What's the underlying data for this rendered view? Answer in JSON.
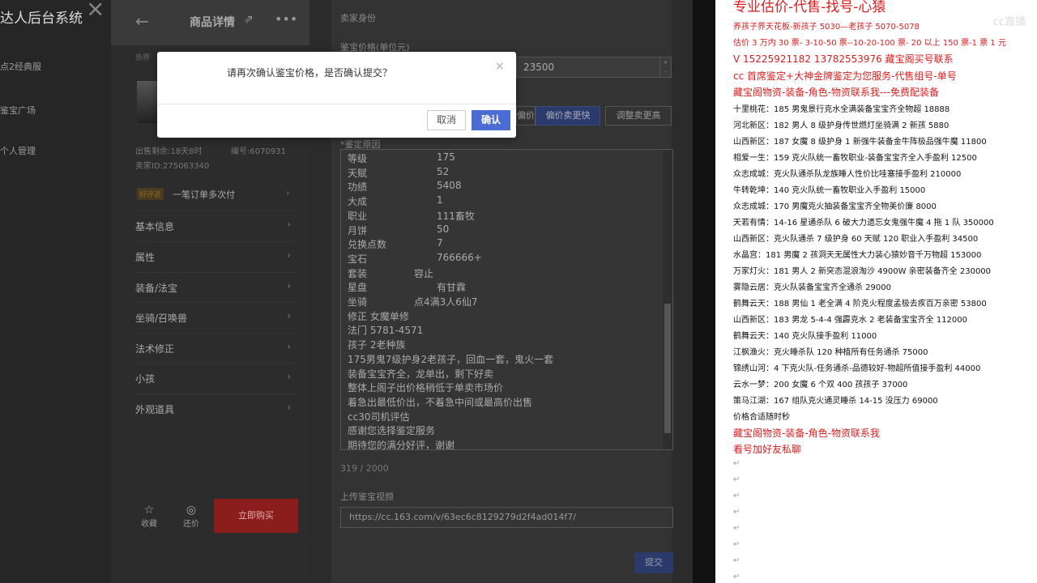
{
  "sidebar": {
    "brand": "达人后台系统",
    "items": [
      "点2经典服",
      "鉴宝广场",
      "个人管理"
    ]
  },
  "product": {
    "title": "商品详情",
    "crumb": "热界",
    "listed": "出售剩余:18天8时",
    "id_label": "编号:6070931",
    "seller": "卖家ID:275063340",
    "promo_tag": "好评返",
    "promo_text": "一笔订单多次付",
    "menu": [
      "基本信息",
      "属性",
      "装备/法宝",
      "坐骑/召唤兽",
      "法术修正",
      "小孩",
      "外观道具"
    ],
    "fav": "收藏",
    "bargain": "还价",
    "buy": "立即购买"
  },
  "form": {
    "section": "卖家身份",
    "price_label": "鉴宝价格(单位元)",
    "price_value": "23500",
    "tabs": [
      "偏价",
      "偏价卖更快",
      "调整卖更高"
    ],
    "reason_label": "*鉴定原因",
    "reason_lines": [
      [
        "等级",
        "175"
      ],
      [
        "天赋",
        "52"
      ],
      [
        "功绩",
        "5408"
      ],
      [
        "大成",
        "1"
      ],
      [
        "职业",
        "111畜牧"
      ],
      [
        "月饼",
        "50"
      ],
      [
        "兑换点数",
        "7"
      ],
      [
        "宝石",
        "766666+"
      ],
      [
        "套装",
        "容止"
      ],
      [
        "星盘",
        "有甘霖"
      ],
      [
        "坐骑",
        "点4满3人6仙7"
      ]
    ],
    "reason_free": [
      "修正 女魔单修",
      "法门 5781-4571",
      "孩子                2老种族",
      "175男鬼7级护身2老孩子，回血一套，鬼火一套",
      "装备宝宝齐全，龙单出，剩下好卖",
      "整体上阁子出价格稍低于单卖市场价",
      "着急出最低价出，不着急中间或最高价出售",
      "cc30司机评估",
      "感谢您选择鉴定服务",
      "期待您的满分好评，谢谢"
    ],
    "counter": "319 / 2000",
    "video_label": "上传鉴宝视频",
    "video_url": "https://cc.163.com/v/63ec6c8129279d2f4ad014f7/",
    "submit": "提交"
  },
  "dialog": {
    "message": "请再次确认鉴宝价格，是否确认提交？",
    "cancel": "取消",
    "ok": "确认"
  },
  "doc": {
    "title": "专业估价-代售-找号-心猿",
    "watermark": "cc直播",
    "lines": [
      {
        "t": "养孩子界天花板-新孩子 5030—老孩子 5070-5078",
        "red": true
      },
      {
        "t": "估价 3 万内 30 票- 3-10-50 票--10-20-100 票- 20 以上 150 票-1 票 1 元",
        "red": true
      },
      {
        "t": "V 15225921182      13782553976    藏宝阁买号联系",
        "red": true,
        "mid": true
      },
      {
        "t": "cc 首席鉴定+大神金牌鉴定为您服务-代售组号-单号",
        "red": true,
        "mid": true
      },
      {
        "t": "藏宝阁物资-装备-角色-物资联系我---免费配装备",
        "red": true,
        "mid": true
      },
      {
        "t": "十里桃花：185 男鬼景行克水全满装备宝宝齐全物超 18888",
        "red": false
      },
      {
        "t": "河北新区：182 男人 8 级护身传世燃灯坐骑满 2 新孩 5880",
        "red": false
      },
      {
        "t": "山西新区：187 女魔 8 级护身 1 新强牛装备金牛阵极品强牛魔 11800",
        "red": false
      },
      {
        "t": "相爱一生：159 克火队统一畜牧职业-装备宝宝齐全入手盈利 12500",
        "red": false
      },
      {
        "t": "众志成城：克火队通杀队龙族睡人性价比哇塞接手盈利 210000",
        "red": false
      },
      {
        "t": "牛转乾坤：140 克火队统一畜牧职业入手盈利 15000",
        "red": false
      },
      {
        "t": "众志成城：170 男魔克火抽装备宝宝齐全物美价廉 8000",
        "red": false
      },
      {
        "t": "天若有情：14-16 星通杀队 6 破大力遗忘女鬼强牛魔 4 拖 1 队 350000",
        "red": false
      },
      {
        "t": "山西新区：克火队通杀 7 级护身 60 天赋 120 职业入手盈利 34500",
        "red": false
      },
      {
        "t": "水晶宫：181 男魔 2 孩洞天无属性大力装心猿妙音千万物超 153000",
        "red": false
      },
      {
        "t": "万家灯火：181 男人 2 新突态混浪淘沙 4900W 亲密装备齐全 230000",
        "red": false
      },
      {
        "t": "雾隐云居：克火队装备宝宝齐全通杀 29000",
        "red": false
      },
      {
        "t": "鹤舞云天：188 男仙 1 老全满 4 阶克火程度孟极去疾百万亲密 53800",
        "red": false
      },
      {
        "t": "山西新区：183 男龙 5-4-4 强霹克水 2 老装备宝宝齐全 112000",
        "red": false
      },
      {
        "t": "鹤舞云天：140 克火队接手盈利 11000",
        "red": false
      },
      {
        "t": "江枫渔火：克火睡杀队 120 种植所有任务通杀 75000",
        "red": false
      },
      {
        "t": "锦绣山河：4 下克火队-任务通杀-品德较好-物超所值接手盈利 44000",
        "red": false
      },
      {
        "t": "云水一梦：200 女魔 6 个双 400 孩孩子 37000",
        "red": false
      },
      {
        "t": "策马江湖：167 组队克火通灵睡杀 14-15 没压力 69000",
        "red": false
      },
      {
        "t": "价格合适随时秒",
        "red": false
      },
      {
        "t": "藏宝阁物资-装备-角色-物资联系我",
        "red": true,
        "mid": true
      },
      {
        "t": "看号加好友私聊",
        "red": true,
        "mid": true
      }
    ]
  }
}
